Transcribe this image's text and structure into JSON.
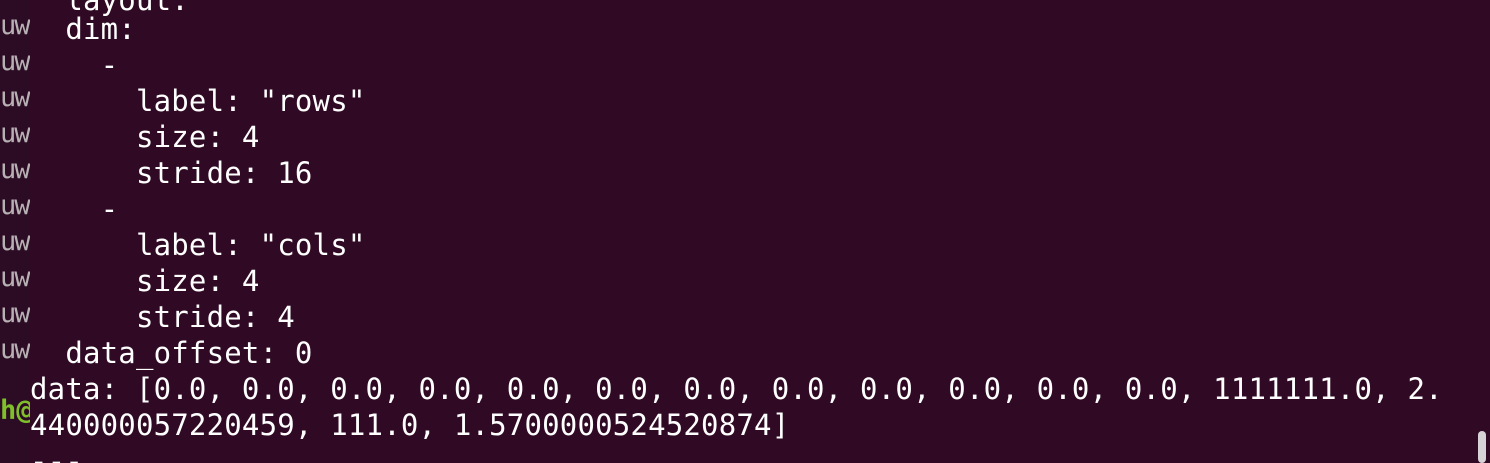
{
  "background_terminal": {
    "gutter_lines": [
      "uw",
      "uw",
      "uw",
      "uw",
      "uw",
      "uw",
      "uw",
      "uw",
      "uw",
      "uw"
    ],
    "prompt_fragment": "h@"
  },
  "terminal": {
    "lines": [
      "  layout:",
      "  dim:",
      "    -",
      "      label: \"rows\"",
      "      size: 4",
      "      stride: 16",
      "    -",
      "      label: \"cols\"",
      "      size: 4",
      "      stride: 4",
      "  data_offset: 0",
      "data: [0.0, 0.0, 0.0, 0.0, 0.0, 0.0, 0.0, 0.0, 0.0, 0.0, 0.0, 0.0, 1111111.0, 2.",
      "440000057220459, 111.0, 1.5700000524520874]",
      "---"
    ]
  },
  "colors": {
    "terminal_bg": "#300a24",
    "text": "#ffffff",
    "prompt_green": "#7fbf2a"
  }
}
